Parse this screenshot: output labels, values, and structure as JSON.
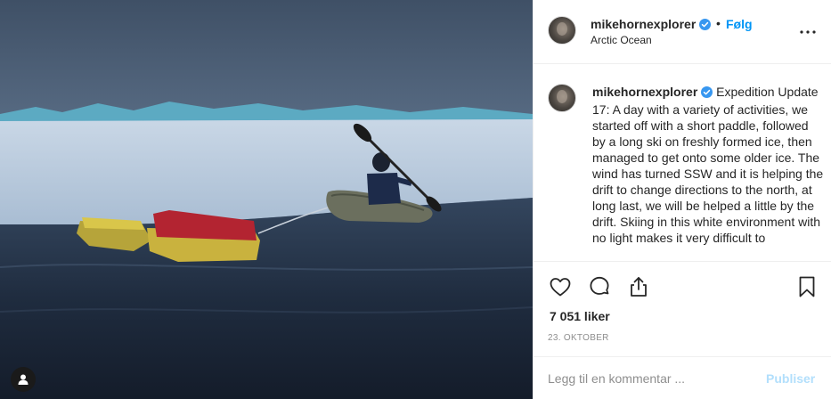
{
  "post": {
    "username": "mikehornexplorer",
    "separator": "•",
    "follow_label": "Følg",
    "location": "Arctic Ocean",
    "caption_user": "mikehornexplorer",
    "caption_text": " Expedition Update 17: A day with a variety of activities, we started off with a short paddle, followed by a long ski on freshly formed ice, then managed to get onto some older ice. The wind has turned SSW and it is helping the drift to change directions to the north, at long last, we will be helped a little by the drift. Skiing in this white environment with no light makes it very difficult to",
    "likes": "7 051 liker",
    "date": "23. OKTOBER"
  },
  "comment": {
    "placeholder": "Legg til en kommentar ...",
    "publish_label": "Publiser"
  },
  "colors": {
    "accent": "#0095f6",
    "publish_disabled": "#b2dffc",
    "verified": "#3897f0"
  },
  "icons": {
    "photo_badge": "user-icon",
    "header_more": "more-options-icon",
    "actions": [
      "heart-icon",
      "comment-icon",
      "share-icon",
      "bookmark-icon"
    ]
  }
}
